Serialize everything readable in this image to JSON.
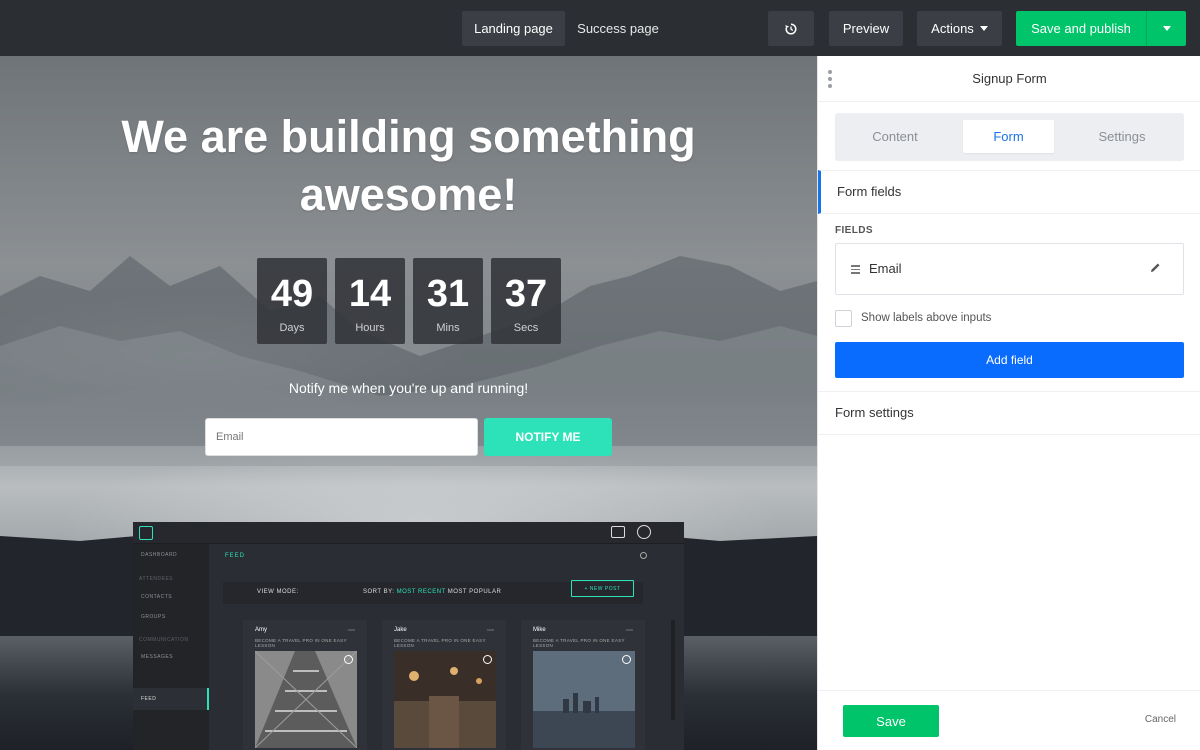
{
  "toolbar": {
    "landing_tab": "Landing page",
    "success_tab": "Success page",
    "history_icon": "history-icon",
    "preview_label": "Preview",
    "actions_label": "Actions",
    "publish_label": "Save and publish",
    "accent_color": "#00c46a"
  },
  "hero": {
    "title_line1": "We are building something",
    "title_line2": "awesome!",
    "countdown": [
      {
        "value": "49",
        "unit": "Days"
      },
      {
        "value": "14",
        "unit": "Hours"
      },
      {
        "value": "31",
        "unit": "Mins"
      },
      {
        "value": "37",
        "unit": "Secs"
      }
    ],
    "notify_text": "Notify me when you're up and running!",
    "email_placeholder": "Email",
    "notify_button": "NOTIFY ME",
    "button_color": "#2de2b9"
  },
  "mockup": {
    "sidebar": {
      "dashboard": "DASHBOARD",
      "attendees_section": "ATTENDEES",
      "contacts": "CONTACTS",
      "groups": "GROUPS",
      "communication_section": "COMMUNICATION",
      "messages": "MESSAGES",
      "feed": "FEED"
    },
    "feed_title": "FEED",
    "view_mode": "VIEW MODE:",
    "sort_by": "SORT BY:",
    "sort_recent": "MOST RECENT",
    "sort_popular": "MOST POPULAR",
    "new_post": "+ NEW POST",
    "cards": [
      {
        "name": "Amy",
        "date": "now",
        "subtitle": "BECOME A TRAVEL PRO IN ONE EASY LESSON"
      },
      {
        "name": "Jake",
        "date": "now",
        "subtitle": "BECOME A TRAVEL PRO IN ONE EASY LESSON"
      },
      {
        "name": "Mike",
        "date": "now",
        "subtitle": "BECOME A TRAVEL PRO IN ONE EASY LESSON"
      }
    ]
  },
  "panel": {
    "title": "Signup Form",
    "tabs": {
      "content": "Content",
      "form": "Form",
      "settings": "Settings"
    },
    "form_fields_section": "Form fields",
    "fields_label": "FIELDS",
    "fields": [
      {
        "name": "Email"
      }
    ],
    "show_labels": "Show labels above inputs",
    "add_field": "Add field",
    "form_settings_section": "Form settings",
    "save_label": "Save",
    "cancel_label": "Cancel"
  }
}
